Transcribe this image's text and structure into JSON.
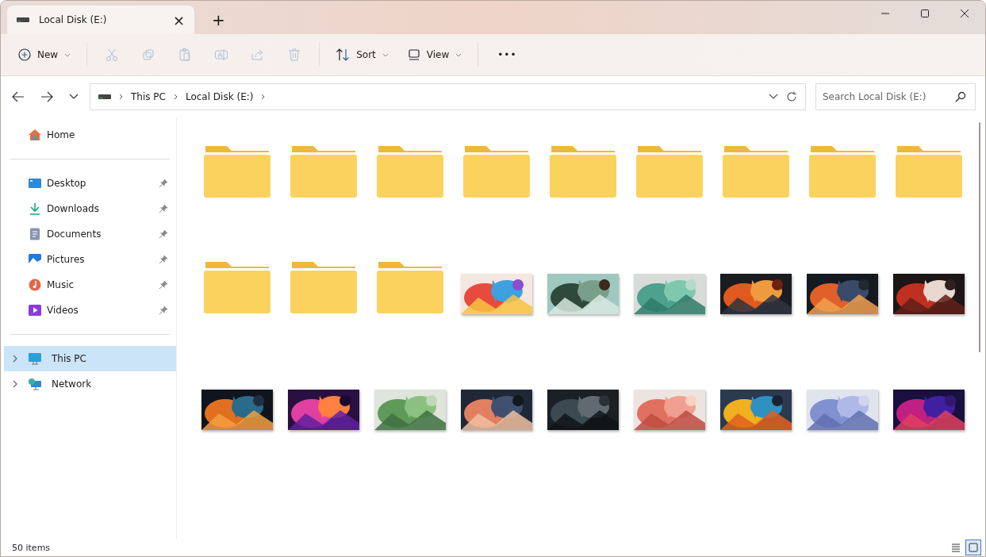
{
  "tab": {
    "title": "Local Disk (E:)",
    "close": "×",
    "new_tab": "+"
  },
  "toolbar": {
    "new_label": "New",
    "actions": [
      {
        "kind": "cut",
        "disabled": true
      },
      {
        "kind": "copy",
        "disabled": true
      },
      {
        "kind": "paste",
        "disabled": true
      },
      {
        "kind": "rename",
        "disabled": true
      },
      {
        "kind": "share",
        "disabled": true
      },
      {
        "kind": "delete",
        "disabled": true
      }
    ],
    "sort_label": "Sort",
    "view_label": "View",
    "more": "•••"
  },
  "breadcrumb": [
    "This PC",
    "Local Disk (E:)"
  ],
  "search": {
    "placeholder": "Search Local Disk (E:)"
  },
  "sidebar": {
    "home": {
      "label": "Home",
      "selected": false
    },
    "quick_access": [
      {
        "label": "Desktop",
        "kind": "desktop",
        "pinned": true
      },
      {
        "label": "Downloads",
        "kind": "downloads",
        "pinned": true
      },
      {
        "label": "Documents",
        "kind": "documents",
        "pinned": true
      },
      {
        "label": "Pictures",
        "kind": "pictures",
        "pinned": true
      },
      {
        "label": "Music",
        "kind": "music",
        "pinned": true
      },
      {
        "label": "Videos",
        "kind": "videos",
        "pinned": true
      }
    ],
    "locations": [
      {
        "label": "This PC",
        "kind": "pc",
        "selected": true,
        "expanded": false
      },
      {
        "label": "Network",
        "kind": "network",
        "selected": false,
        "expanded": false
      }
    ]
  },
  "items": [
    {
      "kind": "folder"
    },
    {
      "kind": "folder"
    },
    {
      "kind": "folder"
    },
    {
      "kind": "folder"
    },
    {
      "kind": "folder"
    },
    {
      "kind": "folder"
    },
    {
      "kind": "folder"
    },
    {
      "kind": "folder"
    },
    {
      "kind": "folder"
    },
    {
      "kind": "folder"
    },
    {
      "kind": "folder"
    },
    {
      "kind": "folder"
    },
    {
      "kind": "picture"
    },
    {
      "kind": "picture"
    },
    {
      "kind": "picture"
    },
    {
      "kind": "picture"
    },
    {
      "kind": "picture"
    },
    {
      "kind": "picture"
    },
    {
      "kind": "picture"
    },
    {
      "kind": "picture"
    },
    {
      "kind": "picture"
    },
    {
      "kind": "picture"
    },
    {
      "kind": "picture"
    },
    {
      "kind": "picture"
    },
    {
      "kind": "picture"
    },
    {
      "kind": "picture"
    },
    {
      "kind": "picture"
    }
  ],
  "status_bar": {
    "count": "50 items",
    "views": [
      {
        "kind": "details",
        "selected": false
      },
      {
        "kind": "large-icons",
        "selected": true
      }
    ]
  }
}
